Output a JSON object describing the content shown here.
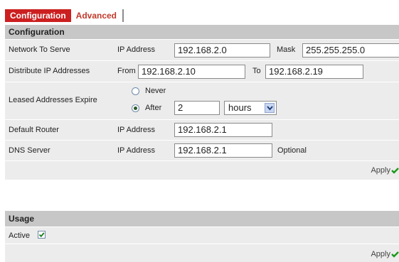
{
  "tabs": [
    {
      "label": "Configuration",
      "active": true
    },
    {
      "label": "Advanced",
      "active": false
    }
  ],
  "configuration": {
    "header": "Configuration",
    "network": {
      "label": "Network To Serve",
      "ip_label": "IP Address",
      "ip_value": "192.168.2.0",
      "mask_label": "Mask",
      "mask_value": "255.255.255.0"
    },
    "distribute": {
      "label": "Distribute IP Addresses",
      "from_label": "From",
      "from_value": "192.168.2.10",
      "to_label": "To",
      "to_value": "192.168.2.19"
    },
    "lease": {
      "label": "Leased Addresses Expire",
      "never_label": "Never",
      "after_label": "After",
      "after_value": "2",
      "unit": "hours",
      "selected": "After"
    },
    "router": {
      "label": "Default Router",
      "ip_label": "IP Address",
      "ip_value": "192.168.2.1"
    },
    "dns": {
      "label": "DNS Server",
      "ip_label": "IP Address",
      "ip_value": "192.168.2.1",
      "note": "Optional"
    },
    "apply_label": "Apply"
  },
  "usage": {
    "header": "Usage",
    "active_label": "Active",
    "active_checked": true,
    "apply_label": "Apply"
  },
  "colors": {
    "tab_active_bg": "#cc1f1f",
    "tab_inactive_text": "#c0392b",
    "header_bg": "#c7c7c7",
    "row_bg": "#ececec",
    "apply_check": "#1a9a1a"
  }
}
